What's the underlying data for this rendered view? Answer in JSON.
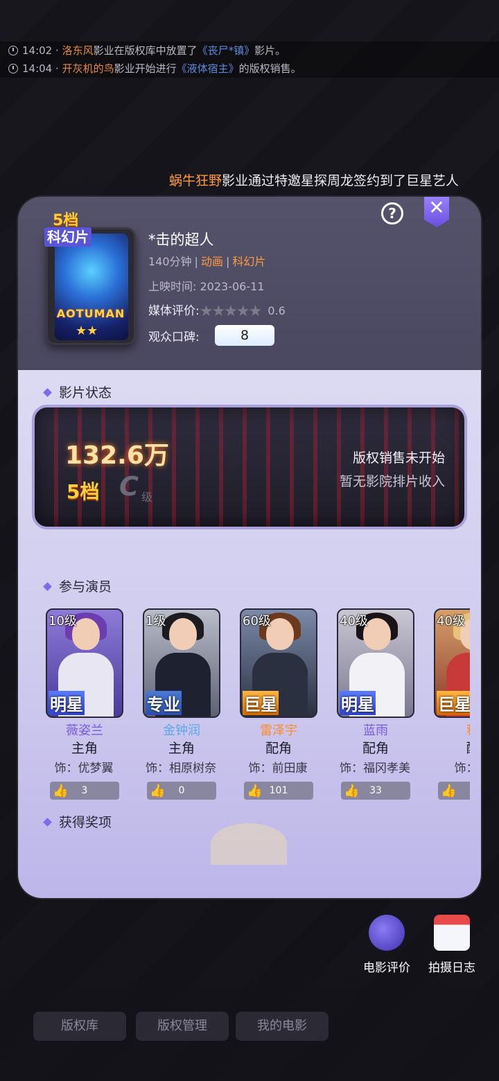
{
  "ticker": [
    {
      "time": "14:02",
      "sep": "·",
      "actor": "洛东风",
      "mid": "影业在版权库中放置了",
      "film": "《丧尸*镇》",
      "end": "影片。"
    },
    {
      "time": "14:04",
      "sep": "·",
      "actor": "开灰机的鸟",
      "mid": "影业开始进行",
      "film": "《液体宿主》",
      "end": "的版权销售。"
    }
  ],
  "broadcast": {
    "studio": "蜗牛狂野",
    "text": "影业通过特邀星探周龙签约到了巨星艺人"
  },
  "panel": {
    "help_label": "?",
    "close_label": "✕",
    "poster": {
      "tier": "5档",
      "genre": "科幻片",
      "title_art": "AOTUMAN",
      "stars": "★★"
    },
    "movie": {
      "title": "*击的超人",
      "duration": "140分钟",
      "sep": "|",
      "type": "动画",
      "genre": "科幻片",
      "release_label": "上映时间:",
      "release_date": "2023-06-11",
      "media_label": "媒体评价:",
      "media_stars": "★★★★★",
      "media_score": "0.6",
      "wom_label": "观众口碑:",
      "wom_value": "8"
    },
    "status": {
      "section_title": "影片状态",
      "box_office": "132.6万",
      "tier": "5档",
      "grade": "C",
      "grade_suffix": "级",
      "copyright_status": "版权销售未开始",
      "theater_income": "暂无影院排片收入"
    },
    "cast": {
      "section_title": "参与演员",
      "actors": [
        {
          "level": "10级",
          "rank": "明星",
          "name": "薇姿兰",
          "name_color": "#7a5ae0",
          "role": "主角",
          "character": "饰：优梦翼",
          "likes": "3"
        },
        {
          "level": "1级",
          "rank": "专业",
          "name": "金钟润",
          "name_color": "#5aa8e8",
          "role": "主角",
          "character": "饰：相原树奈",
          "likes": "0"
        },
        {
          "level": "60级",
          "rank": "巨星",
          "name": "雷泽宇",
          "name_color": "#ff8a2a",
          "role": "配角",
          "character": "饰：前田康",
          "likes": "101"
        },
        {
          "level": "40级",
          "rank": "明星",
          "name": "蓝雨",
          "name_color": "#7a5ae0",
          "role": "配角",
          "character": "饰：福冈孝美",
          "likes": "33"
        },
        {
          "level": "40级",
          "rank": "巨星",
          "name": "科",
          "name_color": "#ff8a2a",
          "role": "配",
          "character": "饰：江",
          "likes": ""
        }
      ]
    },
    "awards": {
      "section_title": "获得奖项"
    }
  },
  "side_actions": [
    {
      "label": "电影评价",
      "icon": "review-quill-icon"
    },
    {
      "label": "拍摄日志",
      "icon": "calendar-icon"
    }
  ],
  "bottom_tabs": [
    "版权库",
    "版权管理",
    "我的电影"
  ],
  "colors": {
    "accent": "#7d6bea",
    "orange": "#ff9b3c",
    "panel_top": "#4a4760",
    "panel_bottom": "#d6d3f1"
  }
}
